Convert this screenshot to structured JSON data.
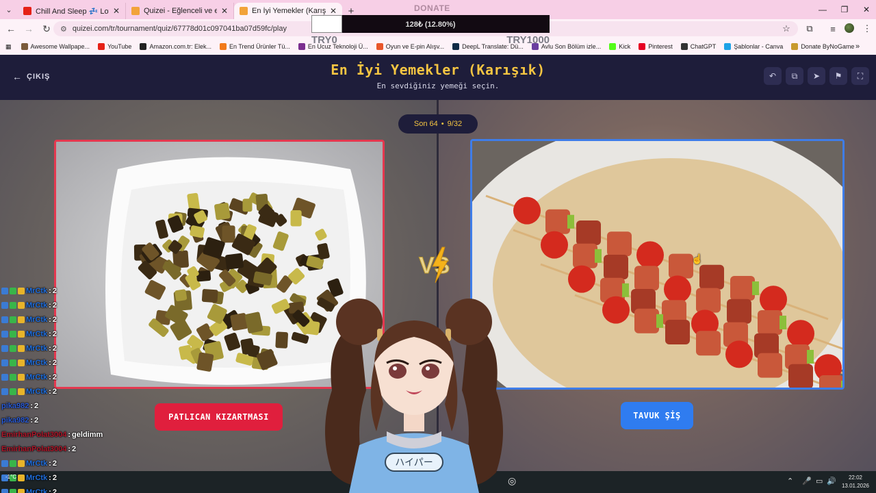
{
  "browser": {
    "tabs": [
      {
        "title": "Chill And Sleep 💤 Lofi cat",
        "favicon_color": "#e62117",
        "active": false
      },
      {
        "title": "Quizei - Eğlenceli ve etkileşimli",
        "favicon_color": "#f2a33a",
        "active": false
      },
      {
        "title": "En İyi Yemekler (Karışık) - Tier L",
        "favicon_color": "#f2a33a",
        "active": true
      }
    ],
    "url": "quizei.com/tr/tournament/quiz/67778d01c097041ba07d59fc/play",
    "bookmarks": [
      {
        "label": "Awesome Wallpape...",
        "color": "#7b5a3b"
      },
      {
        "label": "YouTube",
        "color": "#e62117"
      },
      {
        "label": "Amazon.com.tr: Elek...",
        "color": "#222222"
      },
      {
        "label": "En Trend Ürünler Tü...",
        "color": "#f27a1a"
      },
      {
        "label": "En Ucuz Teknoloji Ü...",
        "color": "#7b2e8f"
      },
      {
        "label": "Oyun ve E-pin Alışv...",
        "color": "#e8562a"
      },
      {
        "label": "DeepL Translate: Dü...",
        "color": "#0f2b46"
      },
      {
        "label": "Avlu Son Bölüm izle...",
        "color": "#6a3fa0"
      },
      {
        "label": "Kick",
        "color": "#53fc18"
      },
      {
        "label": "Pinterest",
        "color": "#e60023"
      },
      {
        "label": "ChatGPT",
        "color": "#333333"
      },
      {
        "label": "Şablonlar - Canva",
        "color": "#1ea2e6"
      },
      {
        "label": "Donate ByNoGame",
        "color": "#c89a2e"
      }
    ]
  },
  "donate": {
    "label": "DONATE",
    "progress_text": "128₺ (12.80%)",
    "progress_fraction": 0.128,
    "min": "TRY0",
    "max": "TRY1000"
  },
  "quiz": {
    "exit_label": "ÇIKIŞ",
    "title": "En İyi Yemekler (Karışık)",
    "subtitle": "En sevdiğiniz yemeği seçin.",
    "round": "Son 64",
    "separator": "•",
    "progress": "9/32",
    "left_choice": "PATLICAN KIZARTMASI",
    "right_choice": "TAVUK ŞİŞ"
  },
  "chat": [
    {
      "user": "MrCtk",
      "msg": "2",
      "badges": true,
      "color": "#1f6fe0"
    },
    {
      "user": "MrCtk",
      "msg": "2",
      "badges": true,
      "color": "#1f6fe0"
    },
    {
      "user": "MrCtk",
      "msg": "2",
      "badges": true,
      "color": "#1f6fe0"
    },
    {
      "user": "MrCtk",
      "msg": "2",
      "badges": true,
      "color": "#1f6fe0"
    },
    {
      "user": "MrCtk",
      "msg": "2",
      "badges": true,
      "color": "#1f6fe0"
    },
    {
      "user": "MrCtk",
      "msg": "2",
      "badges": true,
      "color": "#1f6fe0"
    },
    {
      "user": "MrCtk",
      "msg": "2",
      "badges": true,
      "color": "#1f6fe0"
    },
    {
      "user": "MrCtk",
      "msg": "2",
      "badges": true,
      "color": "#1f6fe0"
    },
    {
      "user": "pika982",
      "msg": "2",
      "badges": false,
      "color": "#2a5bd6"
    },
    {
      "user": "pika982",
      "msg": "2",
      "badges": false,
      "color": "#2a5bd6"
    },
    {
      "user": "EmirhanPolat3004",
      "msg": "geldimm",
      "badges": false,
      "color": "#b0162a"
    },
    {
      "user": "EmirhanPolat3004",
      "msg": "2",
      "badges": false,
      "color": "#b0162a"
    },
    {
      "user": "MrCtk",
      "msg": "2",
      "badges": true,
      "color": "#1f6fe0"
    },
    {
      "user": "MrCtk",
      "msg": "2",
      "badges": true,
      "color": "#1f6fe0"
    },
    {
      "user": "MrCtk",
      "msg": "2",
      "badges": true,
      "color": "#1f6fe0"
    }
  ],
  "taskbar": {
    "time": "22:02",
    "date": "13.01.2026",
    "weather": "-1°C"
  },
  "colors": {
    "header_bg": "#1e1d3a",
    "title": "#f5c542",
    "left_accent": "#e5384f",
    "right_accent": "#3f7de8"
  },
  "icons": {
    "back": "arrow-left-icon",
    "forward": "arrow-right-icon",
    "reload": "reload-icon",
    "star": "star-icon",
    "extensions": "puzzle-icon",
    "undo": "undo-icon",
    "share": "share-icon",
    "send": "send-icon",
    "flag": "flag-icon",
    "fullscreen": "fullscreen-icon",
    "vs": "vs-lightning-icon"
  }
}
